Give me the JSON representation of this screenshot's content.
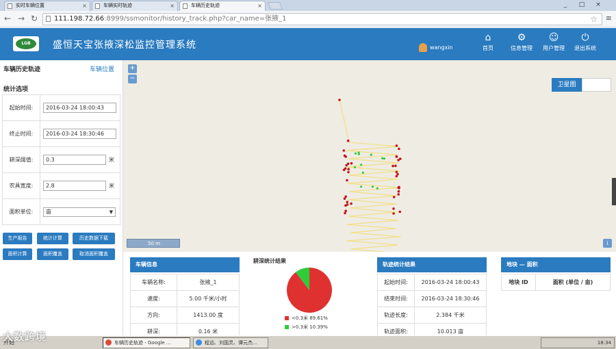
{
  "browser": {
    "tabs": [
      "实时车辆位置",
      "车辆实时轨迹",
      "车辆历史轨迹"
    ],
    "url_host": "111.198.72.66",
    "url_path": ":8999/ssmonitor/history_track.php?car_name=张掖_1",
    "win_controls": [
      "_",
      "□",
      "×"
    ]
  },
  "header": {
    "logo_text": "LGB",
    "title": "盛恒天宝张掖深松监控管理系统",
    "username": "wangxin",
    "nav": [
      {
        "label": "首页",
        "icon": "home-icon"
      },
      {
        "label": "信息管理",
        "icon": "gear-icon"
      },
      {
        "label": "用户管理",
        "icon": "users-icon"
      },
      {
        "label": "退出系统",
        "icon": "power-icon"
      }
    ]
  },
  "sidebar": {
    "title": "车辆历史轨迹",
    "link": "车辆位置",
    "section": "统计选项",
    "fields": {
      "start_label": "起始时间:",
      "start_value": "2016-03-24 18:00:43",
      "end_label": "终止时间:",
      "end_value": "2016-03-24 18:30:46",
      "depth_label": "耕深阈值:",
      "depth_value": "0.3",
      "depth_unit": "米",
      "width_label": "农具宽度:",
      "width_value": "2.8",
      "width_unit": "米",
      "area_label": "面积单位:",
      "area_value": "亩"
    },
    "buttons": [
      "生产报告",
      "统计计算",
      "历史数据下载",
      "面积计算",
      "面积覆盖",
      "取消面积覆盖"
    ]
  },
  "map": {
    "zoom_in": "+",
    "zoom_out": "−",
    "satellite_label": "卫星图",
    "scale": "50 m",
    "info": "i"
  },
  "vehicle_panel": {
    "title": "车辆信息",
    "rows": [
      {
        "label": "车辆名称:",
        "value": "张掖_1"
      },
      {
        "label": "速度:",
        "value": "5.00 千米/小时"
      },
      {
        "label": "方向:",
        "value": "1413.00 度"
      },
      {
        "label": "耕深:",
        "value": "0.16 米"
      }
    ]
  },
  "chart_data": {
    "type": "pie",
    "title": "耕深统计结果",
    "slices": [
      {
        "label": "<0.3米 89.61%",
        "value": 89.61,
        "color": "#e03131"
      },
      {
        "label": ">0.3米 10.39%",
        "value": 10.39,
        "color": "#2fcc3a"
      }
    ]
  },
  "track_panel": {
    "title": "轨迹统计结果",
    "rows": [
      {
        "label": "起始时间:",
        "value": "2016-03-24 18:00:43"
      },
      {
        "label": "结束时间:",
        "value": "2016-03-24 18:30:46"
      },
      {
        "label": "轨迹长度:",
        "value": "2.384 千米"
      },
      {
        "label": "轨迹面积:",
        "value": "10.013 亩"
      }
    ]
  },
  "area_panel": {
    "title": "地块 — 面积",
    "col1": "地块 ID",
    "col2": "面积 (单位 / 亩)"
  },
  "taskbar": {
    "start": "开始",
    "items": [
      "车辆历史轨迹 - Google ...",
      "程远、刘国灵、谭元杰..."
    ],
    "clock": "18:34"
  },
  "watermark": "大数跨境"
}
